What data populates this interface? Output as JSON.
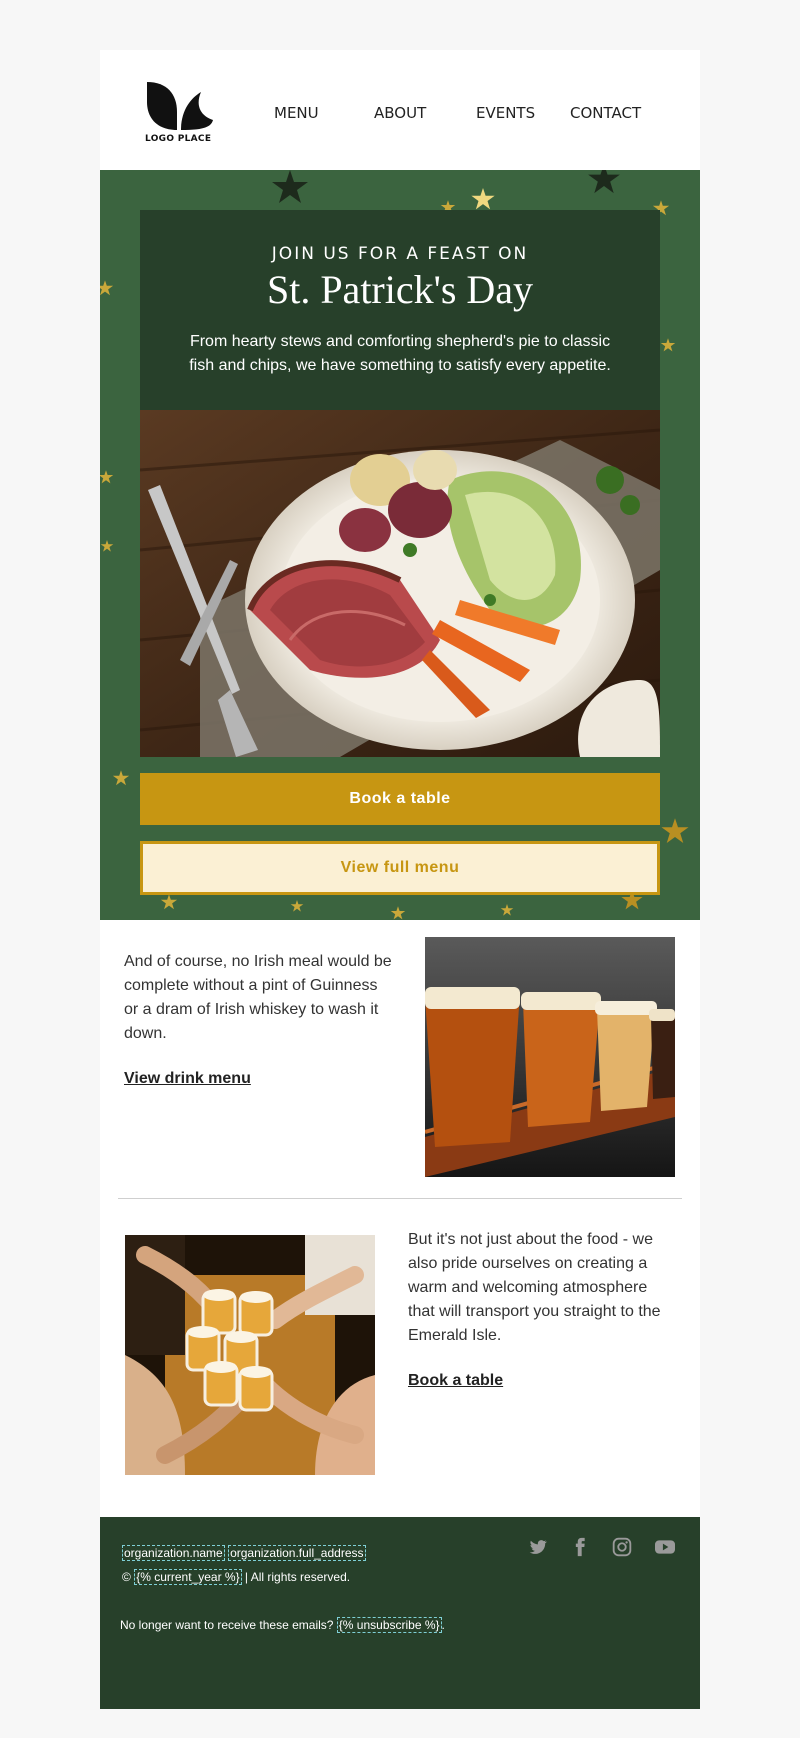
{
  "header": {
    "logo_text": "LOGO PLACE",
    "nav": [
      "MENU",
      "ABOUT",
      "EVENTS",
      "CONTACT"
    ]
  },
  "hero": {
    "kicker": "JOIN US FOR A FEAST ON",
    "title": "St. Patrick's Day",
    "description": "From hearty stews and comforting shepherd's pie to classic fish and chips, we have something to satisfy every appetite.",
    "primary_button": "Book a table",
    "secondary_button": "View full menu"
  },
  "section_drinks": {
    "text": "And of course, no Irish meal would be complete without a pint of Guinness or a dram of Irish whiskey to wash it down.",
    "link": "View drink menu"
  },
  "section_atmosphere": {
    "text": "But it's not just about the food - we also pride ourselves on creating a warm and welcoming atmosphere that will transport you straight to the Emerald Isle.",
    "link": "Book a table"
  },
  "footer": {
    "org_name": "organization.name",
    "org_address": "organization.full_address",
    "copyright_symbol": "©",
    "year_tag": "{% current_year %}",
    "rights": "| All rights reserved.",
    "unsubscribe_text": "No longer want to receive these emails?",
    "unsubscribe_tag": "{% unsubscribe %}",
    "unsubscribe_suffix": ".",
    "social_icons": [
      "twitter-icon",
      "facebook-icon",
      "instagram-icon",
      "youtube-icon"
    ]
  },
  "colors": {
    "page_bg": "#f7f7f7",
    "hero_green": "#3b643f",
    "dark_green": "#27402a",
    "gold": "#c79612",
    "cream": "#fbf0d4"
  }
}
